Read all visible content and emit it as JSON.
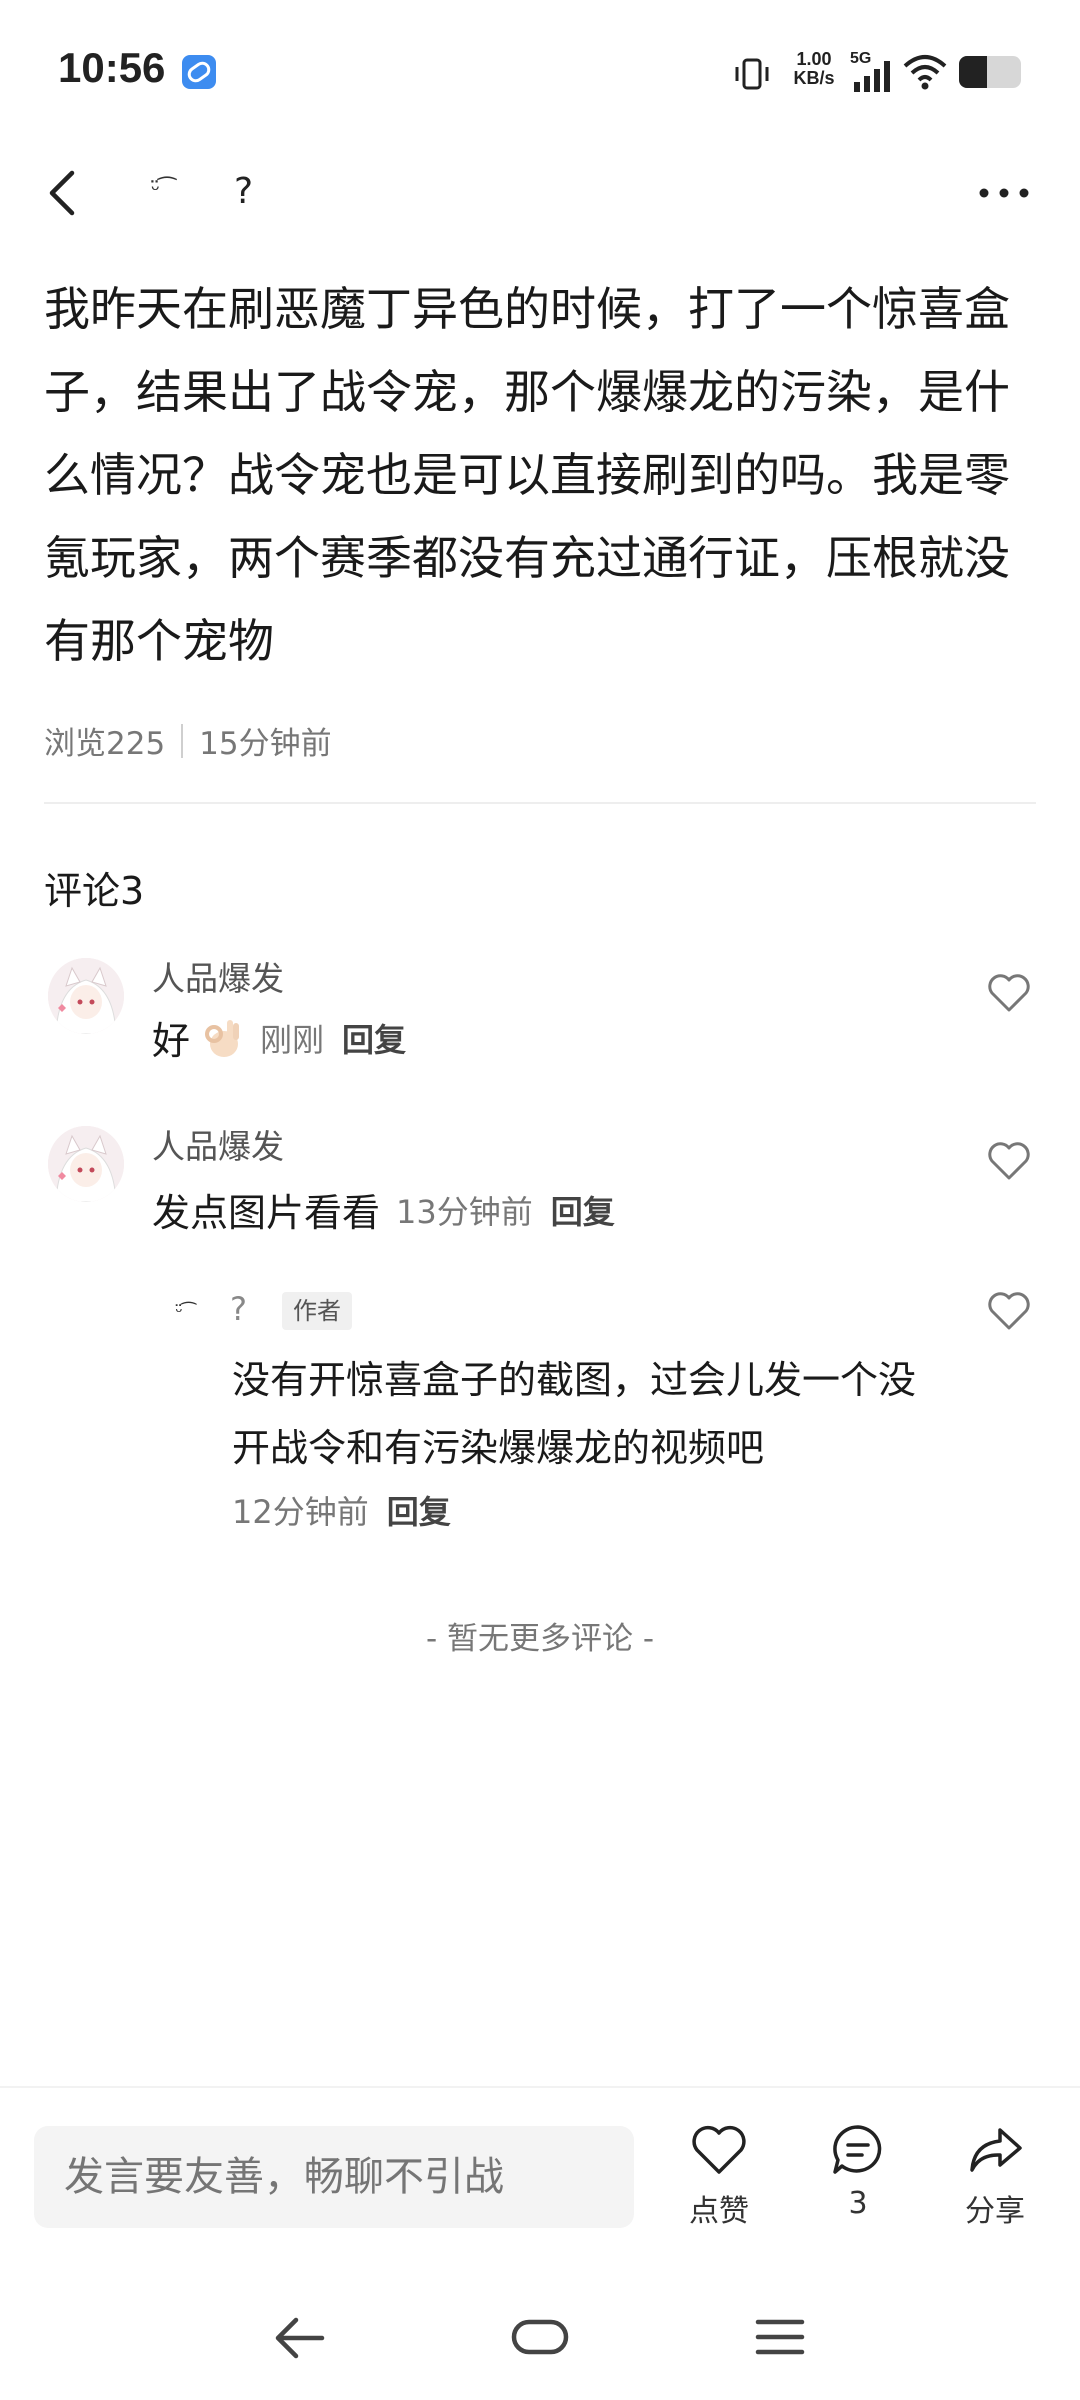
{
  "status_bar": {
    "time": "10:56",
    "net_speed_value": "1.00",
    "net_speed_unit": "KB/s",
    "network_type": "5G",
    "icons": [
      "app-notification-icon",
      "vibrate-icon",
      "signal-icon",
      "wifi-icon",
      "battery-icon"
    ]
  },
  "top_bar": {
    "author_avatar_glyph": "ᵕ̈ ͡",
    "author_name": "?",
    "icons": [
      "back-icon",
      "more-icon"
    ]
  },
  "post": {
    "content": "我昨天在刷恶魔丁异色的时候，打了一个惊喜盒子，结果出了战令宠，那个爆爆龙的污染，是什么情况？战令宠也是可以直接刷到的吗。我是零氪玩家，两个赛季都没有充过通行证，压根就没有那个宠物",
    "views": "浏览225",
    "time": "15分钟前"
  },
  "comments": {
    "title": "评论3",
    "items": [
      {
        "name": "人品爆发",
        "text": "好",
        "emoji": "ok-hand-emoji",
        "time": "刚刚",
        "reply": "回复"
      },
      {
        "name": "人品爆发",
        "text": "发点图片看看",
        "time": "13分钟前",
        "reply": "回复"
      }
    ],
    "reply": {
      "avatar_glyph": "ᵕ̈ ͡",
      "name": "?",
      "badge": "作者",
      "text": "没有开惊喜盒子的截图，过会儿发一个没开战令和有污染爆爆龙的视频吧",
      "time": "12分钟前",
      "reply": "回复"
    },
    "no_more": "- 暂无更多评论 -"
  },
  "bottom_bar": {
    "input_placeholder": "发言要友善，畅聊不引战",
    "like_label": "点赞",
    "comment_count": "3",
    "share_label": "分享"
  },
  "nav_bar": {
    "icons": [
      "nav-back-icon",
      "nav-home-icon",
      "nav-menu-icon"
    ]
  }
}
